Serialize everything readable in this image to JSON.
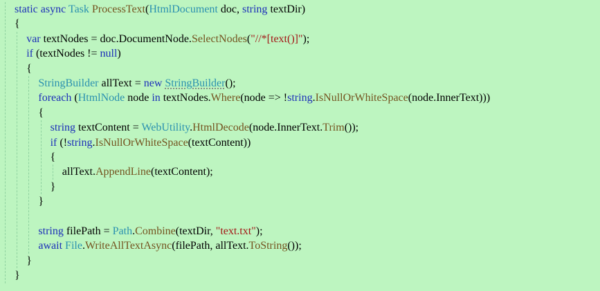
{
  "editor": {
    "lines": [
      {
        "indent": 0,
        "tokens": [
          {
            "t": "static",
            "c": "kw"
          },
          {
            "t": " ",
            "c": "pl"
          },
          {
            "t": "async",
            "c": "kw"
          },
          {
            "t": " ",
            "c": "pl"
          },
          {
            "t": "Task",
            "c": "ty"
          },
          {
            "t": " ",
            "c": "pl"
          },
          {
            "t": "ProcessText",
            "c": "me"
          },
          {
            "t": "(",
            "c": "pl"
          },
          {
            "t": "HtmlDocument",
            "c": "ty"
          },
          {
            "t": " doc, ",
            "c": "pl"
          },
          {
            "t": "string",
            "c": "kw"
          },
          {
            "t": " textDir)",
            "c": "pl"
          }
        ]
      },
      {
        "indent": 0,
        "tokens": [
          {
            "t": "{",
            "c": "pl"
          }
        ]
      },
      {
        "indent": 1,
        "tokens": [
          {
            "t": "var",
            "c": "kw"
          },
          {
            "t": " textNodes = doc.DocumentNode.",
            "c": "pl"
          },
          {
            "t": "SelectNodes",
            "c": "me"
          },
          {
            "t": "(",
            "c": "pl"
          },
          {
            "t": "\"//*[text()]\"",
            "c": "st"
          },
          {
            "t": ");",
            "c": "pl"
          }
        ]
      },
      {
        "indent": 1,
        "tokens": [
          {
            "t": "if",
            "c": "kw"
          },
          {
            "t": " (textNodes != ",
            "c": "pl"
          },
          {
            "t": "null",
            "c": "kw"
          },
          {
            "t": ")",
            "c": "pl"
          }
        ]
      },
      {
        "indent": 1,
        "tokens": [
          {
            "t": "{",
            "c": "pl"
          }
        ]
      },
      {
        "indent": 2,
        "tokens": [
          {
            "t": "StringBuilder",
            "c": "ty"
          },
          {
            "t": " allText = ",
            "c": "pl"
          },
          {
            "t": "new",
            "c": "kw"
          },
          {
            "t": " ",
            "c": "pl"
          },
          {
            "t": "StringBuilder",
            "c": "ty",
            "squig": true
          },
          {
            "t": "();",
            "c": "pl"
          }
        ]
      },
      {
        "indent": 2,
        "tokens": [
          {
            "t": "foreach",
            "c": "kw"
          },
          {
            "t": " (",
            "c": "pl"
          },
          {
            "t": "HtmlNode",
            "c": "ty"
          },
          {
            "t": " node ",
            "c": "pl"
          },
          {
            "t": "in",
            "c": "kw"
          },
          {
            "t": " textNodes.",
            "c": "pl"
          },
          {
            "t": "Where",
            "c": "me"
          },
          {
            "t": "(node => !",
            "c": "pl"
          },
          {
            "t": "string",
            "c": "kw"
          },
          {
            "t": ".",
            "c": "pl"
          },
          {
            "t": "IsNullOrWhiteSpace",
            "c": "me"
          },
          {
            "t": "(node.InnerText)))",
            "c": "pl"
          }
        ]
      },
      {
        "indent": 2,
        "tokens": [
          {
            "t": "{",
            "c": "pl"
          }
        ]
      },
      {
        "indent": 3,
        "tokens": [
          {
            "t": "string",
            "c": "kw"
          },
          {
            "t": " textContent = ",
            "c": "pl"
          },
          {
            "t": "WebUtility",
            "c": "ty"
          },
          {
            "t": ".",
            "c": "pl"
          },
          {
            "t": "HtmlDecode",
            "c": "me"
          },
          {
            "t": "(node.InnerText.",
            "c": "pl"
          },
          {
            "t": "Trim",
            "c": "me"
          },
          {
            "t": "());",
            "c": "pl"
          }
        ]
      },
      {
        "indent": 3,
        "tokens": [
          {
            "t": "if",
            "c": "kw"
          },
          {
            "t": " (!",
            "c": "pl"
          },
          {
            "t": "string",
            "c": "kw"
          },
          {
            "t": ".",
            "c": "pl"
          },
          {
            "t": "IsNullOrWhiteSpace",
            "c": "me"
          },
          {
            "t": "(textContent))",
            "c": "pl"
          }
        ]
      },
      {
        "indent": 3,
        "tokens": [
          {
            "t": "{",
            "c": "pl"
          }
        ]
      },
      {
        "indent": 4,
        "tokens": [
          {
            "t": "allText.",
            "c": "pl"
          },
          {
            "t": "AppendLine",
            "c": "me"
          },
          {
            "t": "(textContent);",
            "c": "pl"
          }
        ]
      },
      {
        "indent": 3,
        "tokens": [
          {
            "t": "}",
            "c": "pl"
          }
        ]
      },
      {
        "indent": 2,
        "tokens": [
          {
            "t": "}",
            "c": "pl"
          }
        ]
      },
      {
        "indent": 0,
        "tokens": []
      },
      {
        "indent": 2,
        "tokens": [
          {
            "t": "string",
            "c": "kw"
          },
          {
            "t": " filePath = ",
            "c": "pl"
          },
          {
            "t": "Path",
            "c": "ty"
          },
          {
            "t": ".",
            "c": "pl"
          },
          {
            "t": "Combine",
            "c": "me"
          },
          {
            "t": "(textDir, ",
            "c": "pl"
          },
          {
            "t": "\"text.txt\"",
            "c": "st"
          },
          {
            "t": ");",
            "c": "pl"
          }
        ]
      },
      {
        "indent": 2,
        "tokens": [
          {
            "t": "await",
            "c": "kw"
          },
          {
            "t": " ",
            "c": "pl"
          },
          {
            "t": "File",
            "c": "ty"
          },
          {
            "t": ".",
            "c": "pl"
          },
          {
            "t": "WriteAllTextAsync",
            "c": "me"
          },
          {
            "t": "(filePath, allText.",
            "c": "pl"
          },
          {
            "t": "ToString",
            "c": "me"
          },
          {
            "t": "());",
            "c": "pl"
          }
        ]
      },
      {
        "indent": 1,
        "tokens": [
          {
            "t": "}",
            "c": "pl"
          }
        ]
      },
      {
        "indent": 0,
        "tokens": [
          {
            "t": "}",
            "c": "pl"
          }
        ]
      }
    ],
    "colors": {
      "background": "#bdf5c0",
      "keyword": "#1c2fb8",
      "type": "#2b91af",
      "method": "#74531f",
      "string": "#a31515",
      "plain": "#000000",
      "indent_guide": "#8fd2a0"
    }
  }
}
